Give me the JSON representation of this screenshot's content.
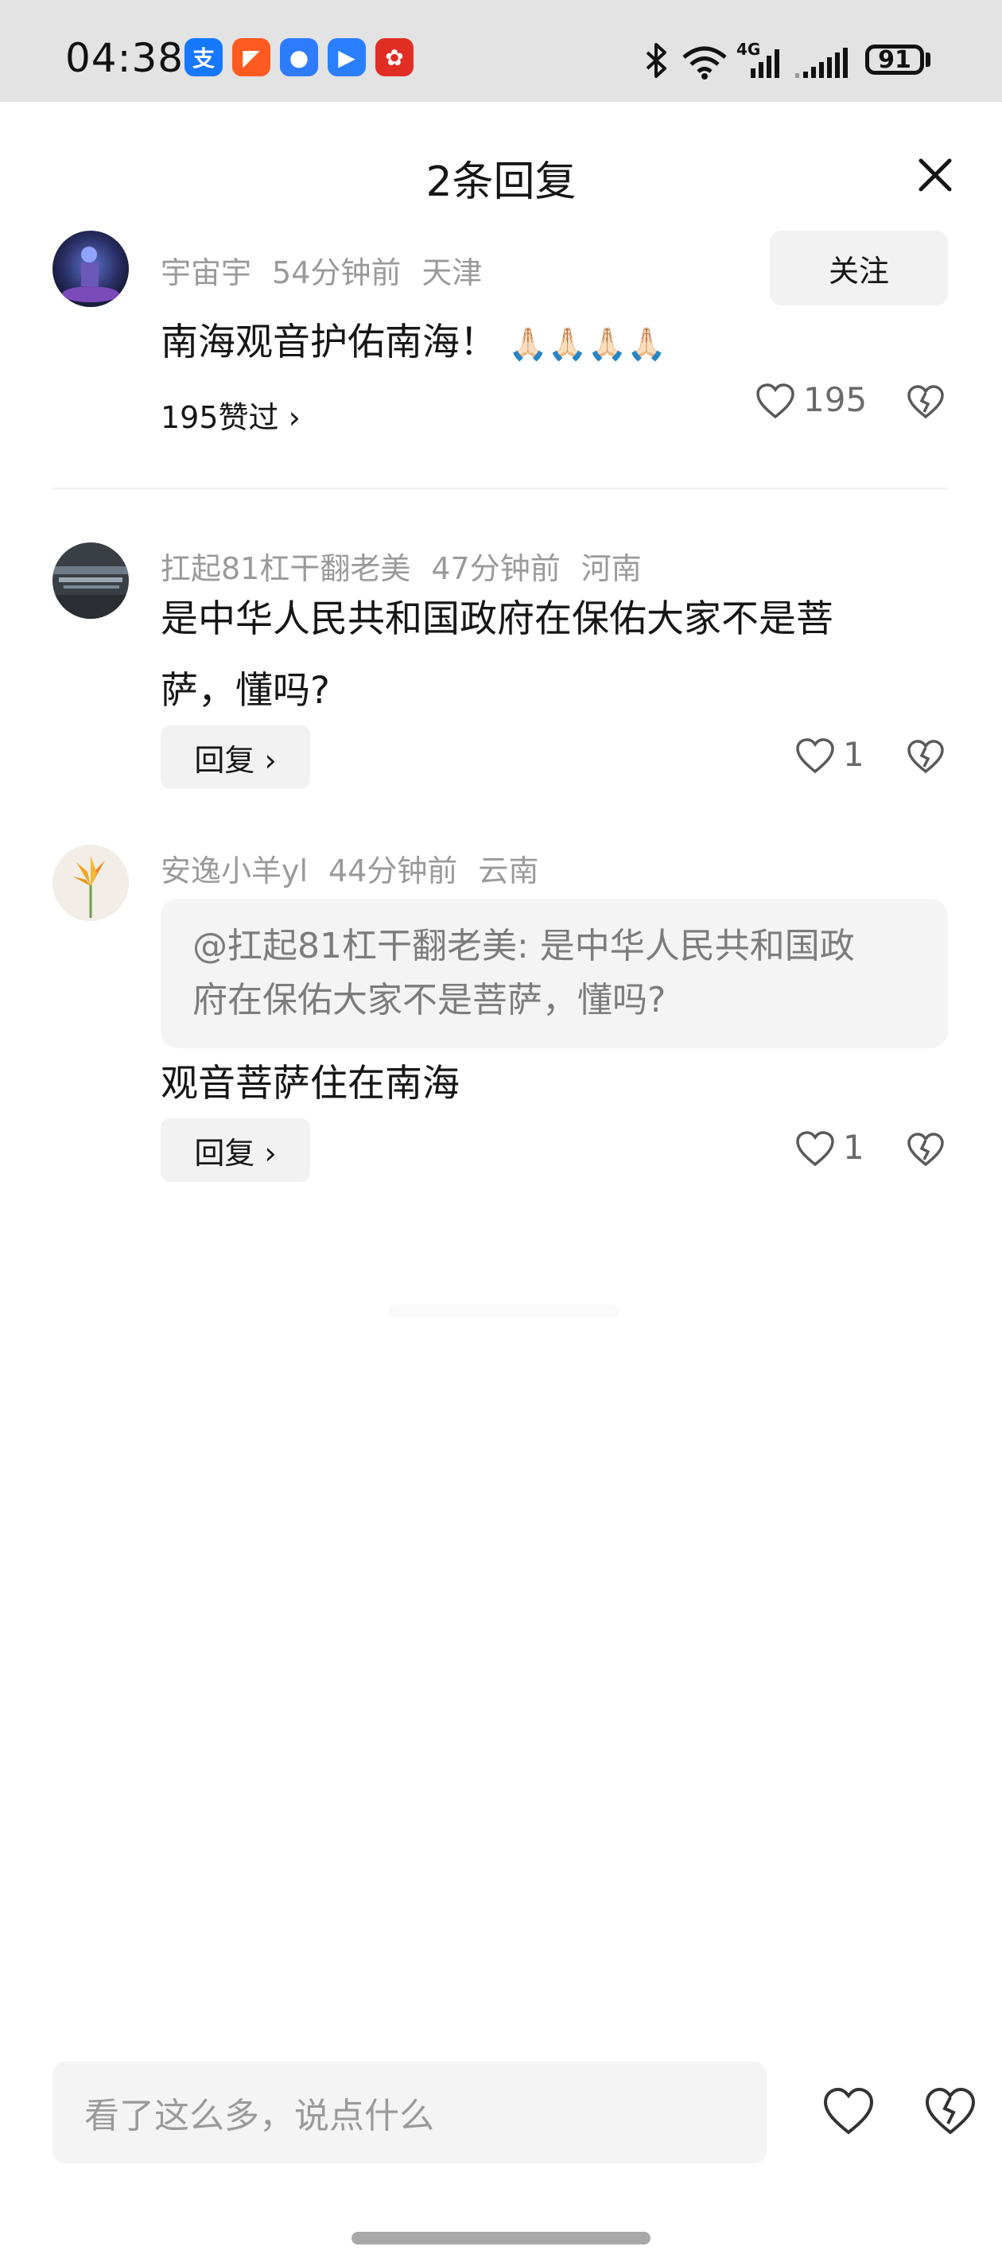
{
  "status_bar": {
    "time": "04:38",
    "apps": [
      {
        "name": "alipay-app-icon",
        "glyph": "支",
        "color": "#1677ff"
      },
      {
        "name": "orange-app-icon",
        "glyph": "◤",
        "color": "#ff5a1f"
      },
      {
        "name": "message-app-icon",
        "glyph": "●",
        "color": "#2f7bff"
      },
      {
        "name": "blue-arrow-app-icon",
        "glyph": "▶",
        "color": "#2a7fff"
      },
      {
        "name": "pinduoduo-app-icon",
        "glyph": "✿",
        "color": "#e02e24"
      }
    ],
    "network": "4G",
    "battery": "91"
  },
  "header": {
    "title": "2条回复"
  },
  "comments": [
    {
      "username": "宇宙宇",
      "time": "54分钟前",
      "location": "天津",
      "follow_label": "关注",
      "text": "南海观音护佑南海！",
      "emoji": "🙏🏻🙏🏻🙏🏻🙏🏻",
      "likes_link": "195赞过 ›",
      "like_count": "195"
    },
    {
      "username": "扛起81杠干翻老美",
      "time": "47分钟前",
      "location": "河南",
      "text_line1": "是中华人民共和国政府在保佑大家不是菩",
      "text_line2": "萨，懂吗?",
      "reply_label": "回复 ›",
      "like_count": "1"
    },
    {
      "username": "安逸小羊yl",
      "time": "44分钟前",
      "location": "云南",
      "quote_line1": "@扛起81杠干翻老美: 是中华人民共和国政",
      "quote_line2": "府在保佑大家不是菩萨，懂吗?",
      "text": "观音菩萨住在南海",
      "reply_label": "回复 ›",
      "like_count": "1"
    }
  ],
  "bottom_bar": {
    "input_placeholder": "看了这么多，说点什么"
  }
}
